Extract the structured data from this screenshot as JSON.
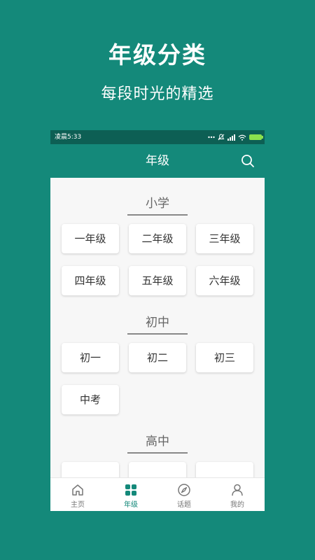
{
  "promo": {
    "headline": "年级分类",
    "subline": "每段时光的精选"
  },
  "status_bar": {
    "time": "凌晨5:33",
    "icons": [
      "more-dots-icon",
      "bell-muted-icon",
      "signal-icon",
      "wifi-icon",
      "battery-icon"
    ]
  },
  "app_bar": {
    "title": "年级",
    "search_icon": "search-icon"
  },
  "sections": [
    {
      "title": "小学",
      "grades": [
        "一年级",
        "二年级",
        "三年级",
        "四年级",
        "五年级",
        "六年级"
      ]
    },
    {
      "title": "初中",
      "grades": [
        "初一",
        "初二",
        "初三",
        "中考"
      ]
    },
    {
      "title": "高中",
      "grades": [
        "",
        "",
        ""
      ]
    }
  ],
  "tab_bar": {
    "active": "grade",
    "tabs": [
      {
        "label": "主页",
        "icon": "home-icon"
      },
      {
        "label": "年级",
        "icon": "grid-icon"
      },
      {
        "label": "话题",
        "icon": "compass-icon"
      },
      {
        "label": "我的",
        "icon": "user-icon"
      }
    ]
  },
  "colors": {
    "brand": "#14897a",
    "status_bar": "#0d5f54",
    "page_bg": "#f7f7f7",
    "battery": "#8be04e"
  }
}
